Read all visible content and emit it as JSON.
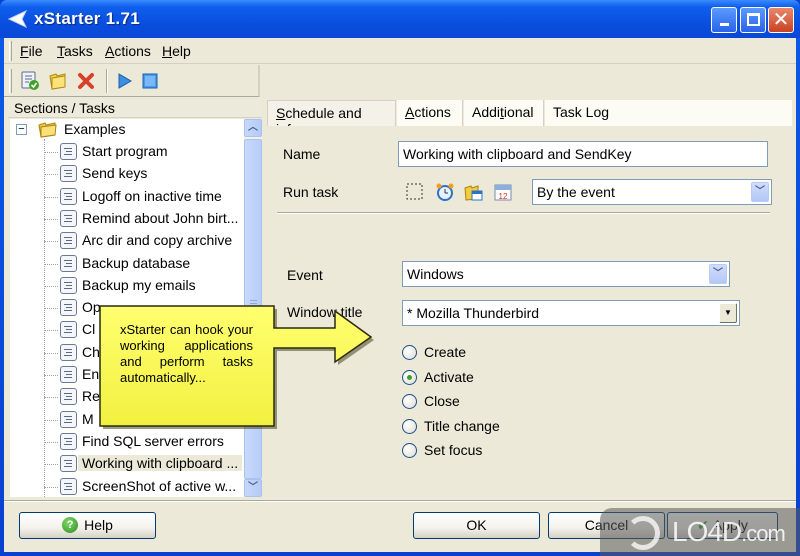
{
  "window": {
    "title": "xStarter 1.71",
    "controls": [
      "minimize",
      "maximize",
      "close"
    ]
  },
  "menu": {
    "items": [
      {
        "label": "File",
        "accel": "F",
        "rest": "ile"
      },
      {
        "label": "Tasks",
        "accel": "T",
        "rest": "asks"
      },
      {
        "label": "Actions",
        "accel": "A",
        "rest": "ctions"
      },
      {
        "label": "Help",
        "accel": "H",
        "rest": "elp"
      }
    ]
  },
  "toolbar": {
    "buttons": [
      {
        "name": "new-task",
        "icon": "task-check-icon"
      },
      {
        "name": "new-section",
        "icon": "folder-icon"
      },
      {
        "name": "delete",
        "icon": "red-x-icon"
      },
      {
        "name": "run",
        "icon": "play-icon"
      },
      {
        "name": "stop",
        "icon": "stop-icon"
      }
    ]
  },
  "sidebar": {
    "header": "Sections / Tasks",
    "root": {
      "label": "Examples",
      "expander": "−"
    },
    "items": [
      {
        "label": "Start program"
      },
      {
        "label": "Send keys"
      },
      {
        "label": "Logoff on inactive time"
      },
      {
        "label": "Remind about John birt..."
      },
      {
        "label": "Arc dir and copy archive"
      },
      {
        "label": "Backup database"
      },
      {
        "label": "Backup my emails"
      },
      {
        "label": "Op"
      },
      {
        "label": "Cl"
      },
      {
        "label": "Ch"
      },
      {
        "label": "En"
      },
      {
        "label": "Re"
      },
      {
        "label": "M"
      },
      {
        "label": "Find SQL server errors"
      },
      {
        "label": "Working with clipboard ...",
        "selected": true
      },
      {
        "label": "ScreenShot of active w..."
      }
    ]
  },
  "tabs": [
    {
      "label": "Schedule and info",
      "accel": "S",
      "rest": "chedule and info",
      "active": true
    },
    {
      "label": "Actions",
      "accel": "A",
      "rest": "ctions"
    },
    {
      "label": "Additional",
      "pre": "Addi",
      "accel": "t",
      "rest": "ional"
    },
    {
      "label": "Task Log"
    }
  ],
  "form": {
    "name_label": "Name",
    "name_value": "Working with clipboard and SendKey",
    "run_task_label": "Run task",
    "run_task_icons": [
      "manual-icon",
      "alarm-clock-icon",
      "folder-window-icon",
      "calendar-icon"
    ],
    "calendar_day": "12",
    "run_task_value": "By the event",
    "event_label": "Event",
    "event_value": "Windows",
    "window_title_label": "Window title",
    "window_title_value": "* Mozilla Thunderbird",
    "radio_options": [
      {
        "label": "Create",
        "checked": false
      },
      {
        "label": "Activate",
        "checked": true
      },
      {
        "label": "Close",
        "checked": false
      },
      {
        "label": "Title change",
        "checked": false
      },
      {
        "label": "Set focus",
        "checked": false
      }
    ]
  },
  "callout": {
    "text": "xStarter can hook your working applications and perform tasks automatically..."
  },
  "buttons": {
    "help": "Help",
    "ok": "OK",
    "cancel": "Cancel",
    "apply": "Apply"
  },
  "watermark": {
    "brand": "LO4D",
    "suffix": ".com"
  }
}
